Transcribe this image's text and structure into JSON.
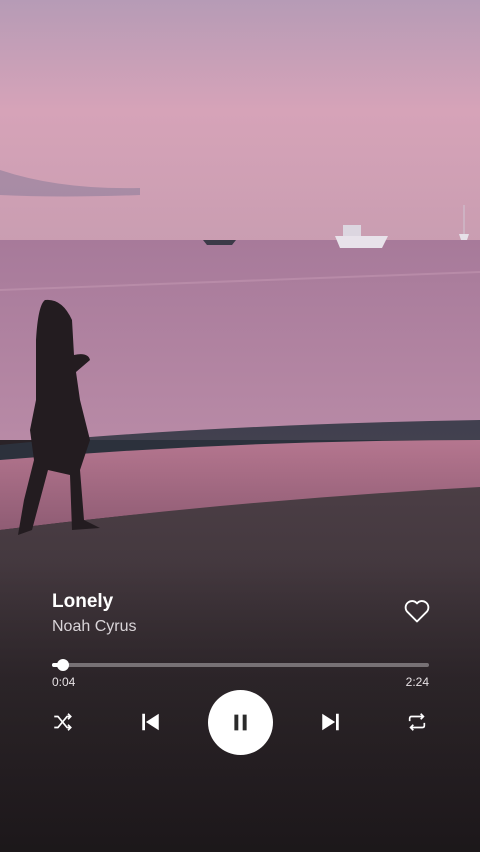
{
  "track": {
    "title": "Lonely",
    "artist": "Noah Cyrus"
  },
  "progress": {
    "elapsed": "0:04",
    "total": "2:24",
    "fraction": 0.03
  },
  "colors": {
    "control": "#ffffff",
    "play_icon": "#2b2b2b"
  },
  "icons": [
    "heart-icon",
    "shuffle-icon",
    "previous-icon",
    "pause-icon",
    "next-icon",
    "repeat-icon"
  ]
}
